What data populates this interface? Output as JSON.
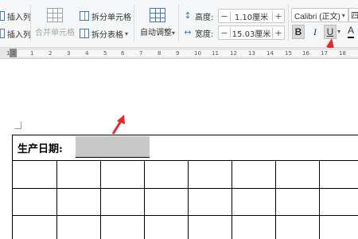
{
  "ribbon": {
    "insert_col_left_1": "插入列",
    "insert_col_left_2": "插入列",
    "merge_cells": "合并单元格",
    "split_cells": "拆分单元格",
    "split_table": "拆分表格",
    "split_table_dd": "▾",
    "auto_fit": "自动调整",
    "auto_fit_dd": "▾",
    "height_label": "高度:",
    "height_value": "1.10厘米",
    "width_label": "宽度:",
    "width_value": "15.03厘米",
    "minus": "−",
    "plus": "+",
    "font_name": "Calibri (正文)",
    "font_dd": "▾",
    "font_size": "四",
    "bold": "B",
    "italic": "I",
    "underline": "U",
    "underline_dd": "▾",
    "font_color": "A"
  },
  "ruler": {
    "ticks": [
      "1",
      "2",
      "1",
      "2",
      "3",
      "4",
      "5",
      "6",
      "7",
      "8",
      "9",
      "10",
      "11",
      "12",
      "13",
      "14",
      "15",
      "16",
      "17",
      "18"
    ]
  },
  "document": {
    "date_label": "生产日期:"
  },
  "colors": {
    "arrow": "#e8262b",
    "ribbon_bg": "#f5f6f7",
    "field_gray": "#c8c8c8"
  }
}
